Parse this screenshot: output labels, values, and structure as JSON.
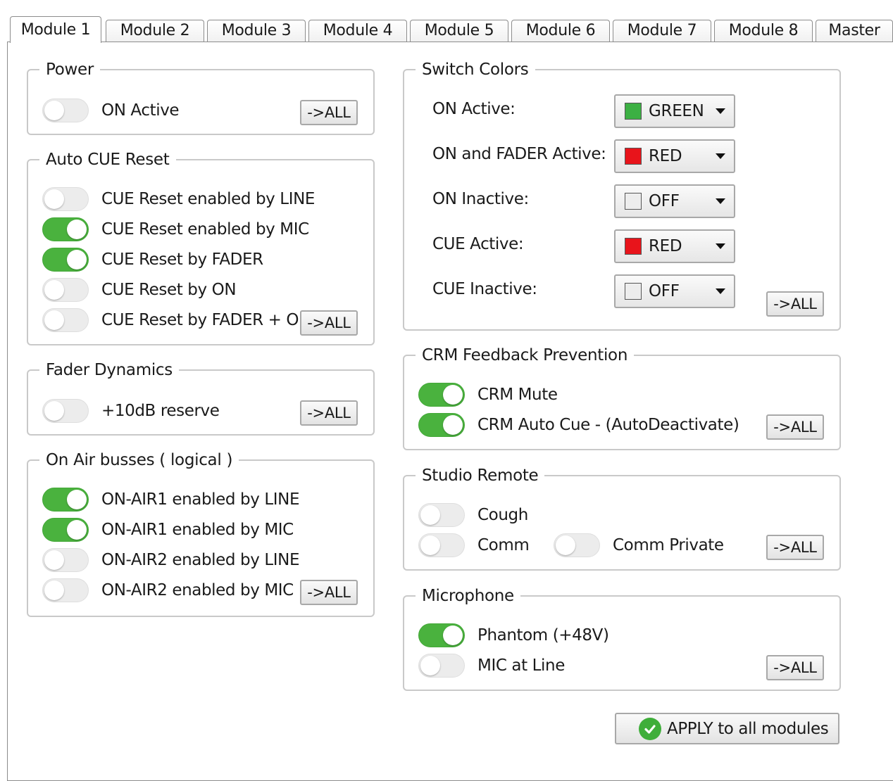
{
  "tabs": [
    "Module 1",
    "Module 2",
    "Module 3",
    "Module 4",
    "Module 5",
    "Module 6",
    "Module 7",
    "Module 8",
    "Master"
  ],
  "power": {
    "title": "Power",
    "items": [
      {
        "label": "ON Active",
        "on": false
      }
    ],
    "all_label": "->ALL"
  },
  "auto_cue_reset": {
    "title": "Auto CUE Reset",
    "items": [
      {
        "label": "CUE Reset enabled by LINE",
        "on": false
      },
      {
        "label": "CUE Reset enabled by MIC",
        "on": true
      },
      {
        "label": "CUE Reset by FADER",
        "on": true
      },
      {
        "label": "CUE Reset by ON",
        "on": false
      },
      {
        "label": "CUE Reset by FADER + ON",
        "on": false
      }
    ],
    "all_label": "->ALL"
  },
  "fader_dynamics": {
    "title": "Fader Dynamics",
    "items": [
      {
        "label": "+10dB reserve",
        "on": false
      }
    ],
    "all_label": "->ALL"
  },
  "on_air_busses": {
    "title": "On Air busses ( logical )",
    "items": [
      {
        "label": "ON-AIR1 enabled by LINE",
        "on": true
      },
      {
        "label": "ON-AIR1 enabled by MIC",
        "on": true
      },
      {
        "label": "ON-AIR2 enabled by LINE",
        "on": false
      },
      {
        "label": "ON-AIR2 enabled by MIC",
        "on": false
      }
    ],
    "all_label": "->ALL"
  },
  "switch_colors": {
    "title": "Switch Colors",
    "items": [
      {
        "label": "ON Active:",
        "value": "GREEN",
        "color": "#3cb043"
      },
      {
        "label": "ON and FADER Active:",
        "value": "RED",
        "color": "#e8141b"
      },
      {
        "label": "ON Inactive:",
        "value": "OFF",
        "color": "#ededed"
      },
      {
        "label": "CUE Active:",
        "value": "RED",
        "color": "#e8141b"
      },
      {
        "label": "CUE Inactive:",
        "value": "OFF",
        "color": "#ededed"
      }
    ],
    "all_label": "->ALL"
  },
  "crm_feedback": {
    "title": "CRM Feedback Prevention",
    "items": [
      {
        "label": "CRM Mute",
        "on": true
      },
      {
        "label": "CRM Auto Cue - (AutoDeactivate)",
        "on": true
      }
    ],
    "all_label": "->ALL"
  },
  "studio_remote": {
    "title": "Studio Remote",
    "items": [
      {
        "label": "Cough",
        "on": false
      },
      {
        "label": "Comm",
        "on": false
      },
      {
        "label": "Comm Private",
        "on": false
      }
    ],
    "all_label": "->ALL"
  },
  "microphone": {
    "title": "Microphone",
    "items": [
      {
        "label": "Phantom (+48V)",
        "on": true
      },
      {
        "label": "MIC at Line",
        "on": false
      }
    ],
    "all_label": "->ALL"
  },
  "apply_label": "APPLY to all modules",
  "colors": {
    "toggle_on": "#4ab23e",
    "toggle_off": "#ececec"
  }
}
